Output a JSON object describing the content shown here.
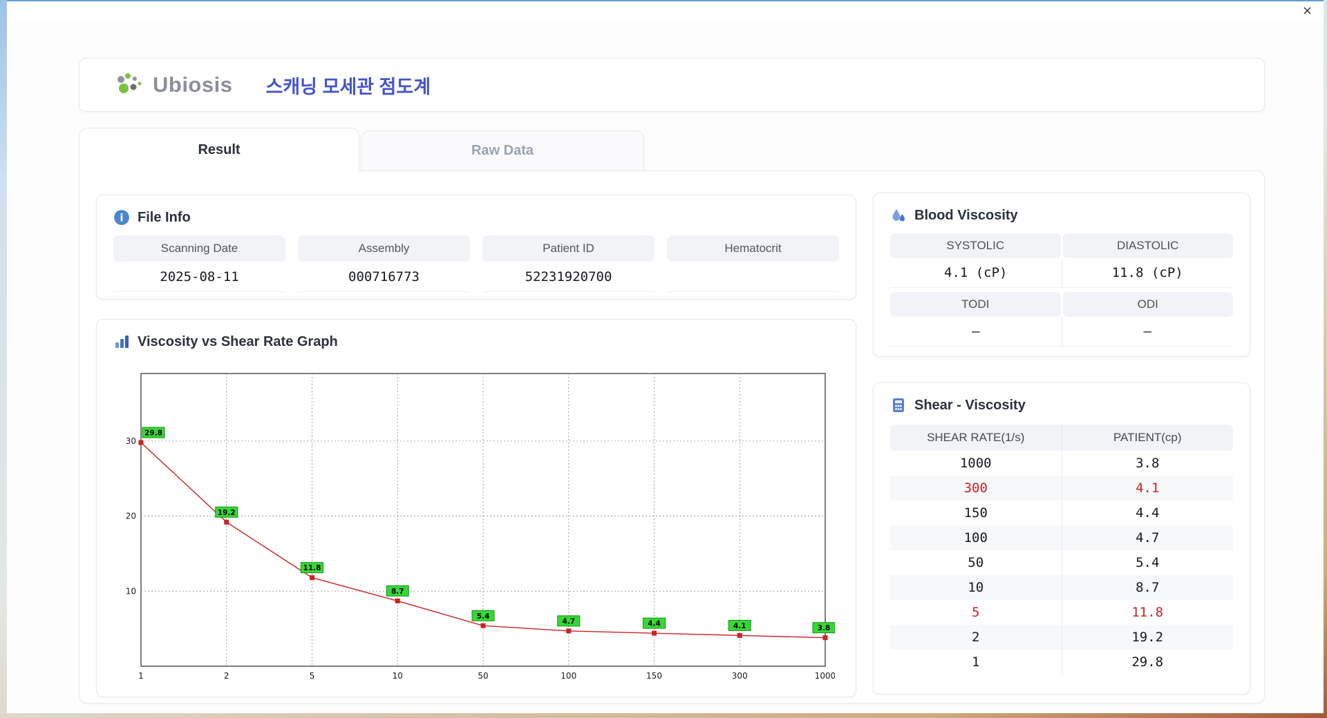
{
  "window": {
    "close_label": "×"
  },
  "header": {
    "logo": "Ubiosis",
    "title": "스캐닝 모세관 점도계"
  },
  "tabs": {
    "result": "Result",
    "raw_data": "Raw Data"
  },
  "file_info": {
    "title": "File Info",
    "fields": [
      {
        "label": "Scanning Date",
        "value": "2025-08-11"
      },
      {
        "label": "Assembly",
        "value": "000716773"
      },
      {
        "label": "Patient ID",
        "value": "52231920700"
      },
      {
        "label": "Hematocrit",
        "value": ""
      }
    ]
  },
  "blood_viscosity": {
    "title": "Blood Viscosity",
    "rows": [
      {
        "left_label": "SYSTOLIC",
        "right_label": "DIASTOLIC",
        "left_value": "4.1 (cP)",
        "right_value": "11.8 (cP)"
      },
      {
        "left_label": "TODI",
        "right_label": "ODI",
        "left_value": "–",
        "right_value": "–"
      }
    ]
  },
  "graph": {
    "title": "Viscosity vs Shear Rate Graph"
  },
  "chart_data": {
    "type": "line",
    "title": "Viscosity vs Shear Rate Graph",
    "x": [
      1,
      2,
      5,
      10,
      50,
      100,
      150,
      300,
      1000
    ],
    "values": [
      29.8,
      19.2,
      11.8,
      8.7,
      5.4,
      4.7,
      4.4,
      4.1,
      3.8
    ],
    "x_scale": "ordinal",
    "xlabel": "",
    "ylabel": "",
    "yticks": [
      10,
      20,
      30
    ],
    "ylim": [
      0,
      39
    ],
    "grid": "dashed",
    "point_labels": true,
    "line_color": "#cc2222",
    "label_bg": "#35d935"
  },
  "shear_viscosity": {
    "title": "Shear - Viscosity",
    "columns": [
      "SHEAR RATE(1/s)",
      "PATIENT(cp)"
    ],
    "rows": [
      {
        "shear_rate": "1000",
        "patient": "3.8",
        "highlight": false
      },
      {
        "shear_rate": "300",
        "patient": "4.1",
        "highlight": true
      },
      {
        "shear_rate": "150",
        "patient": "4.4",
        "highlight": false
      },
      {
        "shear_rate": "100",
        "patient": "4.7",
        "highlight": false
      },
      {
        "shear_rate": "50",
        "patient": "5.4",
        "highlight": false
      },
      {
        "shear_rate": "10",
        "patient": "8.7",
        "highlight": false
      },
      {
        "shear_rate": "5",
        "patient": "11.8",
        "highlight": true
      },
      {
        "shear_rate": "2",
        "patient": "19.2",
        "highlight": false
      },
      {
        "shear_rate": "1",
        "patient": "29.8",
        "highlight": false
      }
    ]
  },
  "colors": {
    "accent_blue": "#4453cc",
    "highlight_red": "#cc2222",
    "label_green": "#35d935",
    "bar_gray": "#f1f3f6"
  }
}
